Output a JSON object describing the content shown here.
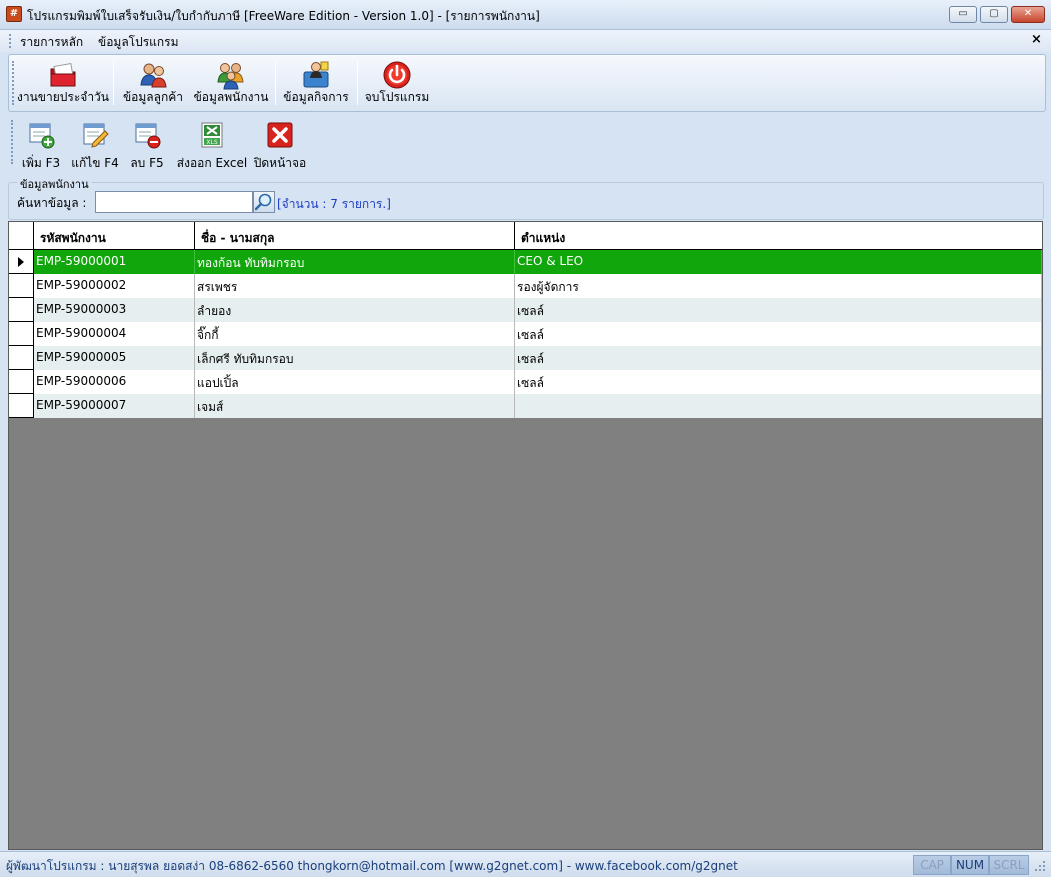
{
  "window": {
    "title": "โปรแกรมพิมพ์ใบเสร็จรับเงิน/ใบกำกับภาษี [FreeWare Edition - Version 1.0] - [รายการพนักงาน]",
    "app_icon_glyph": "#",
    "min_glyph": "▭",
    "max_glyph": "▢",
    "close_glyph": "✕"
  },
  "menu": {
    "items": [
      {
        "label": "รายการหลัก"
      },
      {
        "label": "ข้อมูลโปรแกรม"
      }
    ],
    "close_glyph": "×"
  },
  "main_toolbar": {
    "buttons": [
      {
        "label": "งานขายประจำวัน",
        "icon": "sales-folder-icon"
      },
      {
        "label": "ข้อมูลลูกค้า",
        "icon": "customers-icon"
      },
      {
        "label": "ข้อมูลพนักงาน",
        "icon": "employees-icon"
      },
      {
        "label": "ข้อมูลกิจการ",
        "icon": "business-icon"
      },
      {
        "label": "จบโปรแกรม",
        "icon": "power-icon"
      }
    ]
  },
  "sub_toolbar": {
    "buttons": [
      {
        "label": "เพิ่ม F3",
        "icon": "add-record-icon"
      },
      {
        "label": "แก้ไข F4",
        "icon": "edit-record-icon"
      },
      {
        "label": "ลบ F5",
        "icon": "delete-record-icon"
      },
      {
        "label": "ส่งออก Excel",
        "icon": "excel-export-icon"
      },
      {
        "label": "ปิดหน้าจอ",
        "icon": "close-window-icon"
      }
    ]
  },
  "search": {
    "group_title": "ข้อมูลพนักงาน",
    "label": "ค้นหาข้อมูล :",
    "value": "",
    "count_text": "[จำนวน : 7 รายการ.]"
  },
  "grid": {
    "columns": [
      "รหัสพนักงาน",
      "ชื่อ - นามสกุล",
      "ตำแหน่ง"
    ],
    "rows": [
      {
        "id": "EMP-59000001",
        "name": "ทองก้อน ทับทิมกรอบ",
        "position": "CEO & LEO"
      },
      {
        "id": "EMP-59000002",
        "name": "สรเพชร",
        "position": "รองผู้จัดการ"
      },
      {
        "id": "EMP-59000003",
        "name": "ลำยอง",
        "position": "เซลล์"
      },
      {
        "id": "EMP-59000004",
        "name": "จิ๊กกี้",
        "position": "เซลล์"
      },
      {
        "id": "EMP-59000005",
        "name": "เล็กศรี ทับทิมกรอบ",
        "position": "เซลล์"
      },
      {
        "id": "EMP-59000006",
        "name": "แอปเปิ้ล",
        "position": "เซลล์"
      },
      {
        "id": "EMP-59000007",
        "name": "เจมส์",
        "position": ""
      }
    ],
    "selected_index": 0,
    "selected_color": "#11a60c"
  },
  "status": {
    "text": "ผู้พัฒนาโปรแกรม : นายสุรพล ยอดสง่า 08-6862-6560 thongkorn@hotmail.com [www.g2gnet.com] - www.facebook.com/g2gnet",
    "cap": "CAP",
    "num": "NUM",
    "scrl": "SCRL"
  }
}
